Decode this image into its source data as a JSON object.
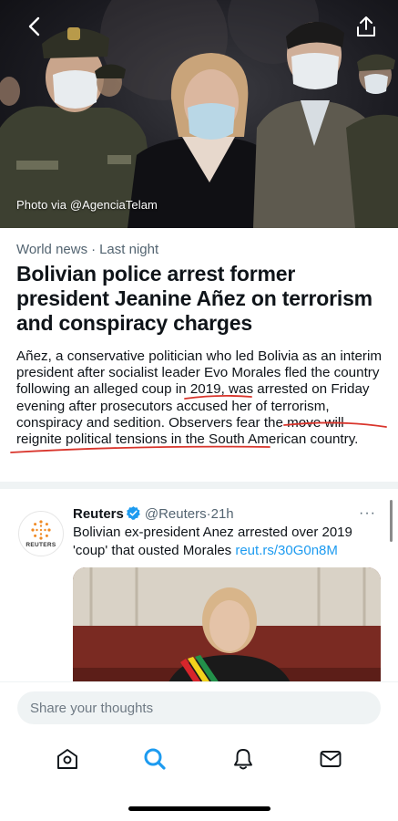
{
  "hero": {
    "caption": "Photo via @AgenciaTelam",
    "back_icon": "chevron-left-icon",
    "share_icon": "share-icon"
  },
  "article": {
    "category": "World news",
    "separator": "·",
    "time": "Last night",
    "headline": "Bolivian police arrest former president Jeanine Añez on terrorism and conspiracy charges",
    "summary": "Añez, a conservative politician who led Bolivia as an interim president after socialist leader Evo Morales fled the country following an alleged coup in 2019, was arrested on Friday evening after prosecutors accused her of terrorism, conspiracy and sedition. Observers fear the move will reignite political tensions in the South American country.",
    "annotation_color": "#d9352c"
  },
  "tweet": {
    "avatar_label": "REUTERS",
    "name": "Reuters",
    "handle": "@Reuters",
    "separator": "·",
    "time": "21h",
    "more": "···",
    "text": "Bolivian ex-president Anez arrested over 2019 'coup' that ousted Morales ",
    "link": "reut.rs/30G0n8M"
  },
  "reply": {
    "placeholder": "Share your thoughts"
  },
  "tabs": [
    {
      "name": "home",
      "icon": "home-icon",
      "active": false
    },
    {
      "name": "search",
      "icon": "search-icon",
      "active": true
    },
    {
      "name": "notifications",
      "icon": "bell-icon",
      "active": false
    },
    {
      "name": "messages",
      "icon": "mail-icon",
      "active": false
    }
  ],
  "colors": {
    "accent": "#1d9bf0",
    "text": "#0f1419",
    "secondary": "#536471",
    "annotation": "#d9352c",
    "reuters_orange": "#f08a24"
  }
}
